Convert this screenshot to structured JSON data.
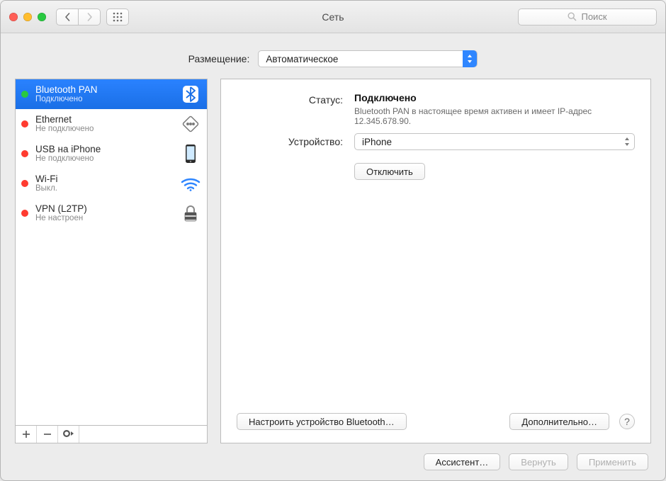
{
  "window_title": "Сеть",
  "search_placeholder": "Поиск",
  "location": {
    "label": "Размещение:",
    "value": "Автоматическое"
  },
  "services": [
    {
      "name": "Bluetooth PAN",
      "status": "Подключено",
      "dot": "green",
      "selected": true,
      "icon": "bluetooth"
    },
    {
      "name": "Ethernet",
      "status": "Не подключено",
      "dot": "red",
      "selected": false,
      "icon": "ethernet"
    },
    {
      "name": "USB на iPhone",
      "status": "Не подключено",
      "dot": "red",
      "selected": false,
      "icon": "iphone"
    },
    {
      "name": "Wi-Fi",
      "status": "Выкл.",
      "dot": "red",
      "selected": false,
      "icon": "wifi"
    },
    {
      "name": "VPN (L2TP)",
      "status": "Не настроен",
      "dot": "red",
      "selected": false,
      "icon": "lock"
    }
  ],
  "detail": {
    "status_label": "Статус:",
    "status_value": "Подключено",
    "status_desc": "Bluetooth PAN в настоящее время активен и имеет IP-адрес 12.345.678.90.",
    "device_label": "Устройство:",
    "device_value": "iPhone",
    "disconnect": "Отключить",
    "configure_bt": "Настроить устройство Bluetooth…",
    "advanced": "Дополнительно…"
  },
  "bottom": {
    "assistant": "Ассистент…",
    "revert": "Вернуть",
    "apply": "Применить"
  }
}
